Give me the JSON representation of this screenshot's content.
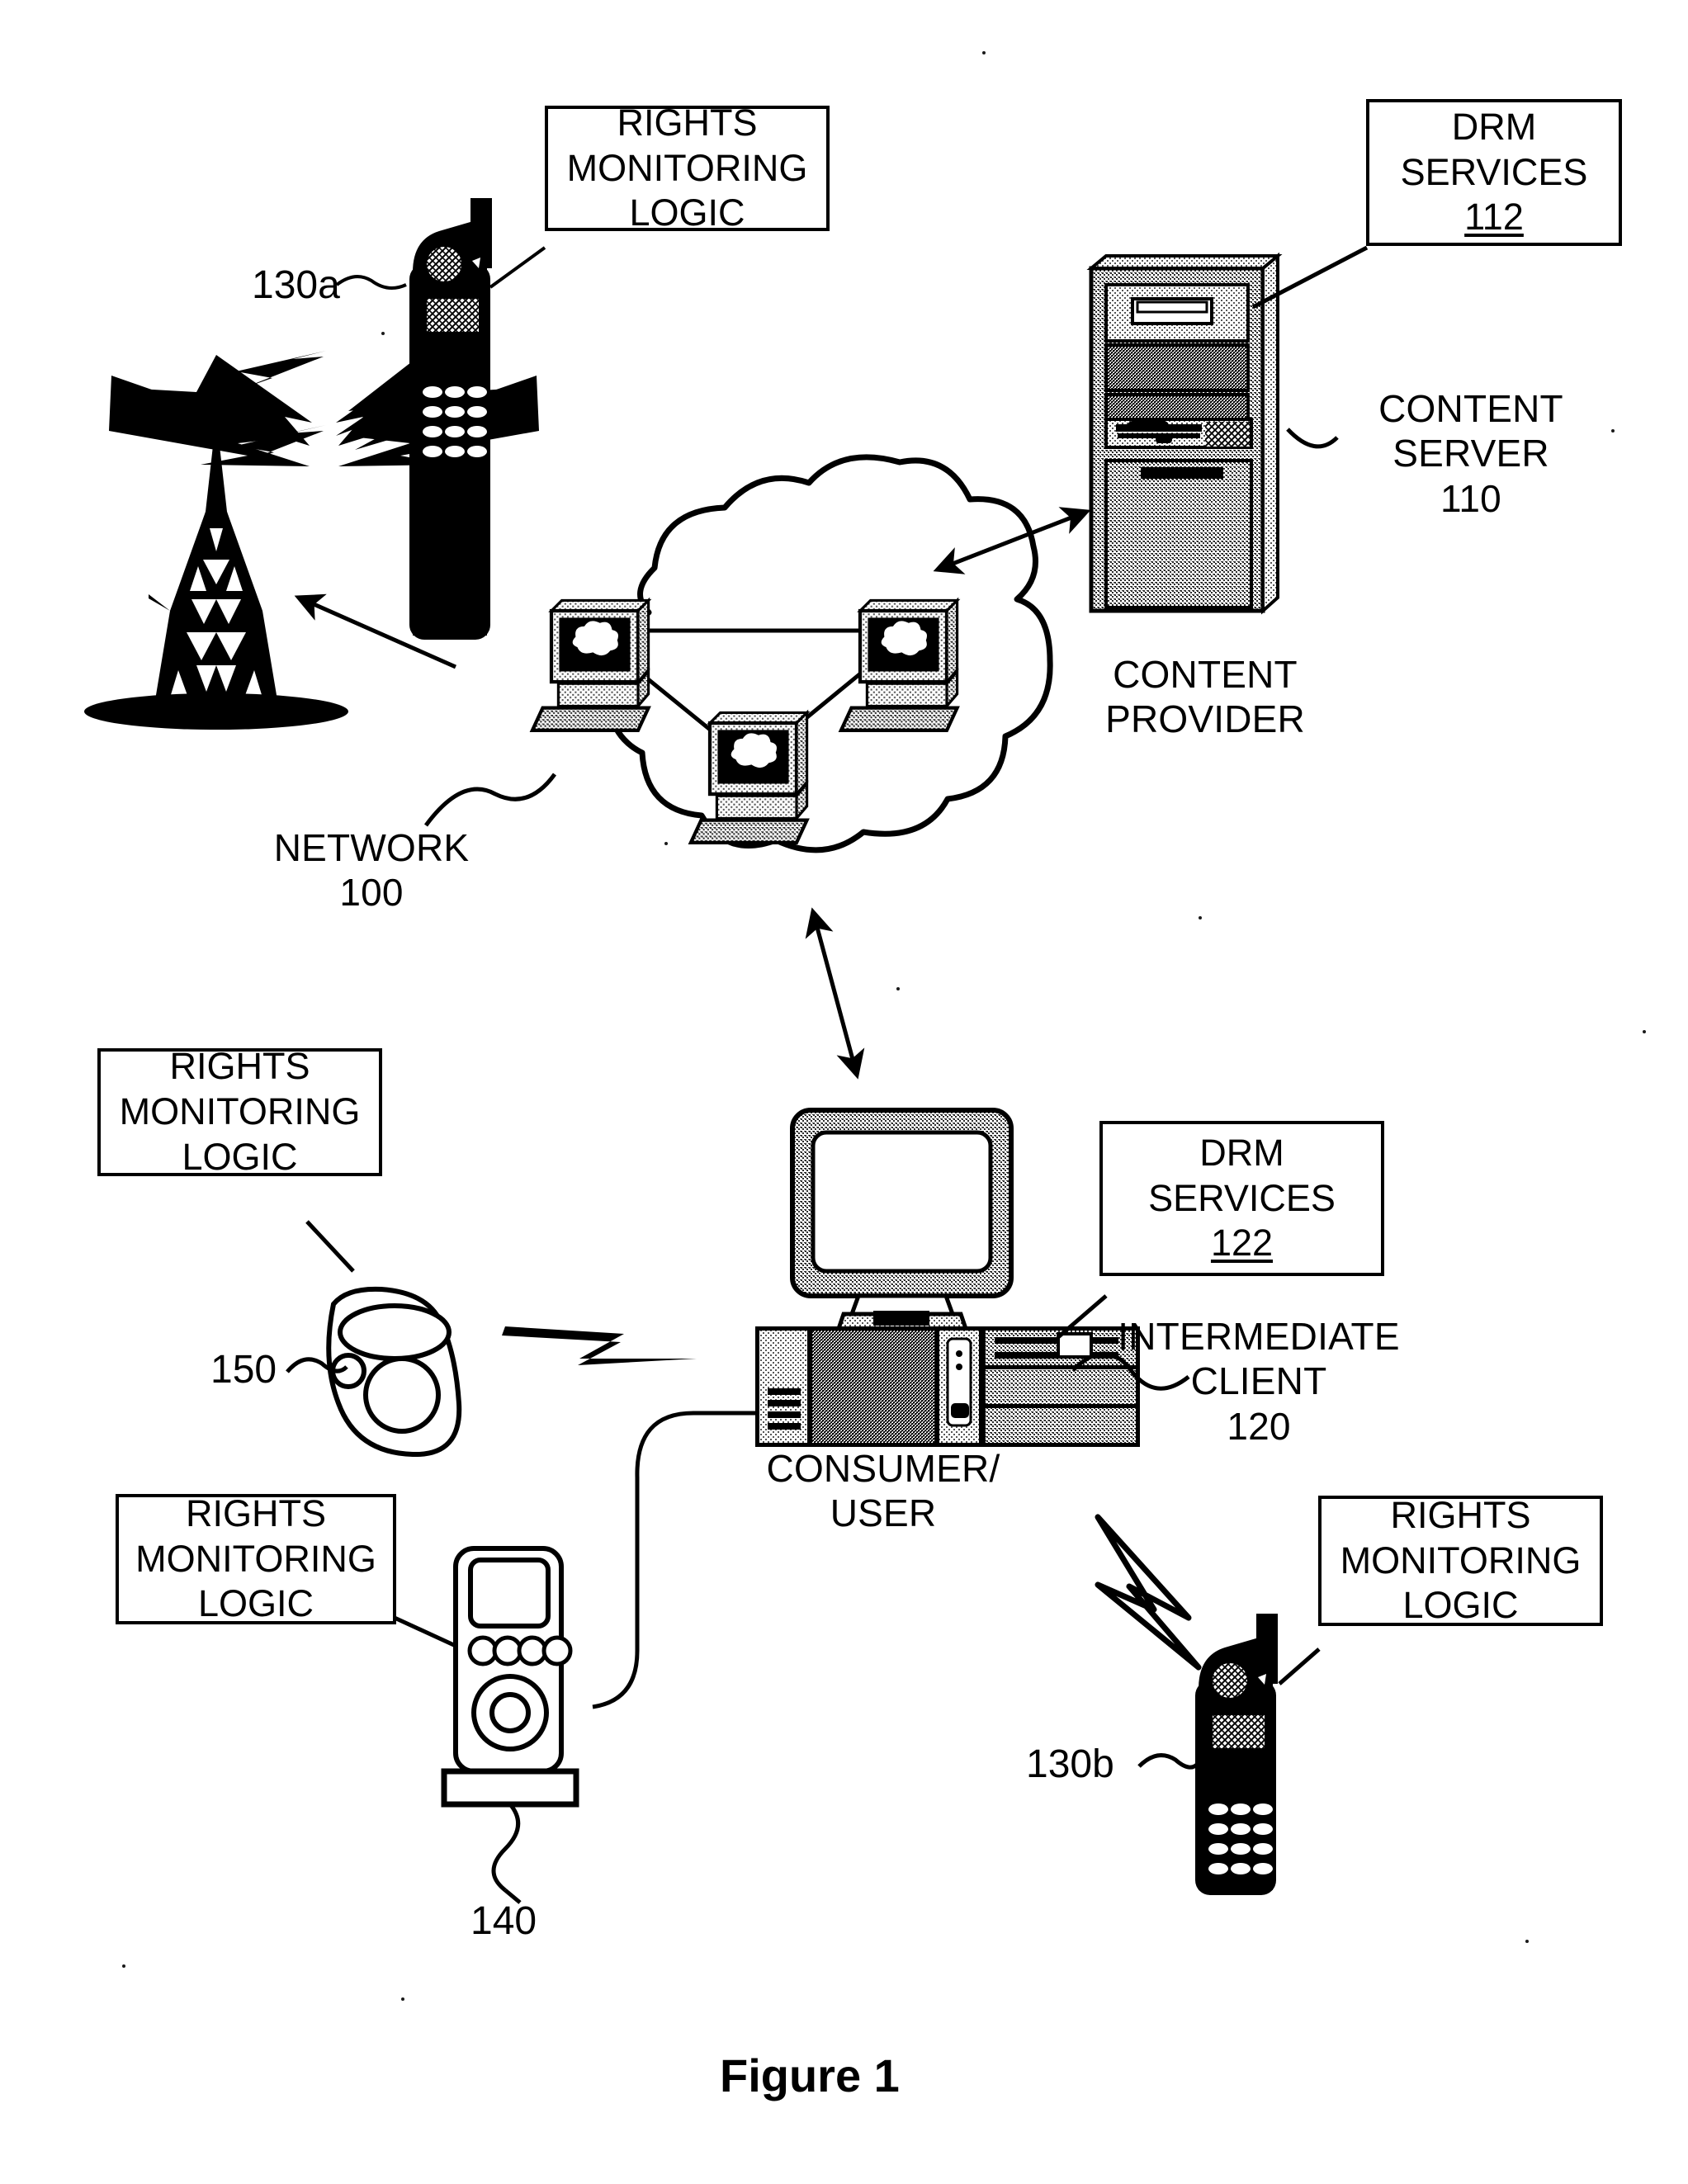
{
  "figure": {
    "caption": "Figure 1",
    "type": "patent-system-diagram"
  },
  "boxes": {
    "rights_logic_phone_a": {
      "line1": "RIGHTS",
      "line2": "MONITORING",
      "line3": "LOGIC"
    },
    "drm_services_server": {
      "line1": "DRM",
      "line2": "SERVICES",
      "ref": "112"
    },
    "rights_logic_device_150": {
      "line1": "RIGHTS",
      "line2": "MONITORING",
      "line3": "LOGIC"
    },
    "drm_services_client": {
      "line1": "DRM",
      "line2": "SERVICES",
      "ref": "122"
    },
    "rights_logic_device_140": {
      "line1": "RIGHTS",
      "line2": "MONITORING",
      "line3": "LOGIC"
    },
    "rights_logic_phone_b": {
      "line1": "RIGHTS",
      "line2": "MONITORING",
      "line3": "LOGIC"
    }
  },
  "labels": {
    "network": "NETWORK\n100",
    "content_server": "CONTENT\nSERVER\n110",
    "content_provider": "CONTENT\nPROVIDER",
    "intermediate_client": "INTERMEDIATE\nCLIENT\n120",
    "consumer_user": "CONSUMER/\nUSER"
  },
  "reference_numerals": {
    "phone_a": "130a",
    "phone_b": "130b",
    "handheld_150": "150",
    "media_player_140": "140"
  },
  "icons": {
    "radio_tower": "radio-tower-icon",
    "mobile_phone_a": "mobile-phone-icon",
    "mobile_phone_b": "mobile-phone-icon",
    "network_cloud": "network-cloud-icon",
    "cloud_node_1": "workstation-icon",
    "cloud_node_2": "workstation-icon",
    "cloud_node_3": "workstation-icon",
    "server_tower": "server-tower-icon",
    "desktop_computer": "desktop-computer-icon",
    "handheld_device": "handheld-device-icon",
    "media_player": "portable-media-player-icon",
    "wireless_bolt_150": "lightning-bolt-icon",
    "wireless_bolt_130b": "lightning-bolt-icon"
  },
  "colors": {
    "ink": "#000000",
    "paper": "#ffffff"
  }
}
